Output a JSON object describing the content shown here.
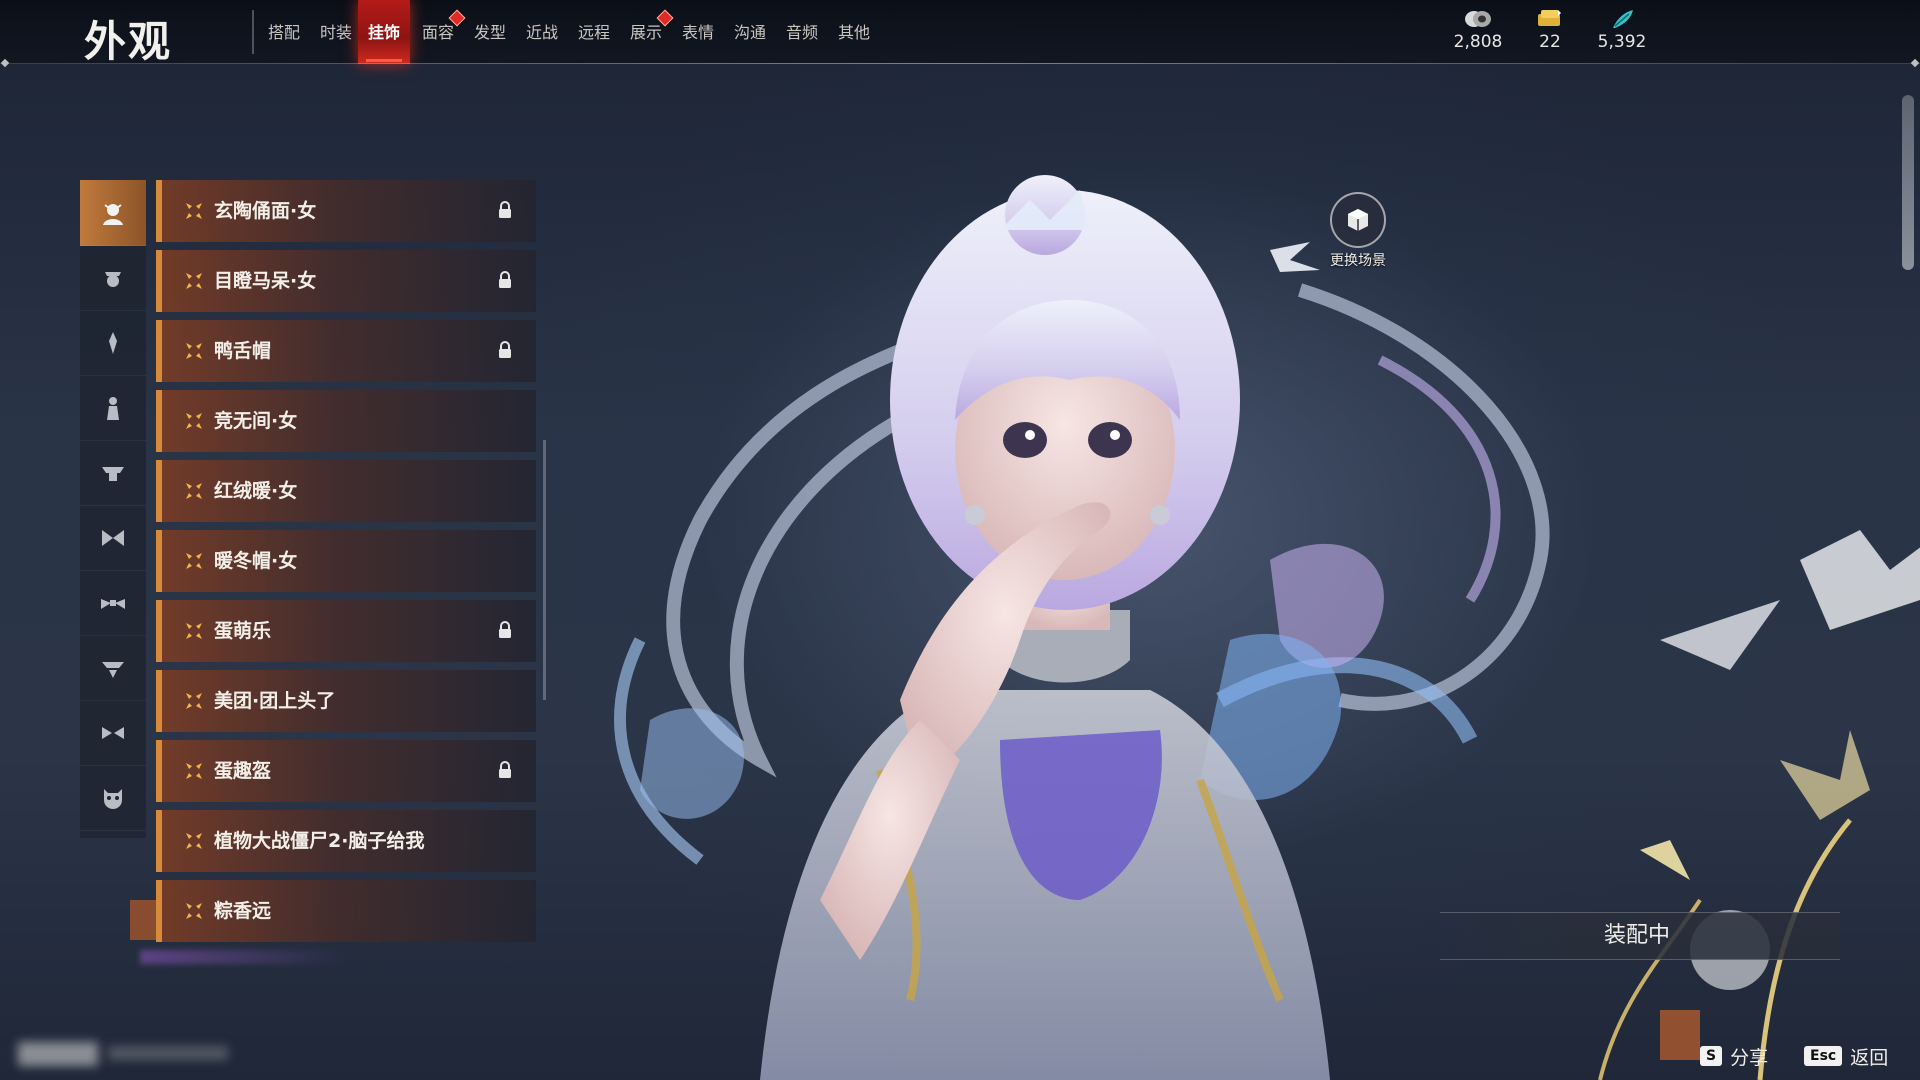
{
  "header": {
    "title": "外观",
    "tabs": [
      {
        "label": "搭配",
        "badge": false
      },
      {
        "label": "时装",
        "badge": false
      },
      {
        "label": "挂饰",
        "badge": false,
        "active": true
      },
      {
        "label": "面容",
        "badge": true
      },
      {
        "label": "发型",
        "badge": false
      },
      {
        "label": "近战",
        "badge": false
      },
      {
        "label": "远程",
        "badge": false
      },
      {
        "label": "展示",
        "badge": true
      },
      {
        "label": "表情",
        "badge": false
      },
      {
        "label": "沟通",
        "badge": false
      },
      {
        "label": "音频",
        "badge": false
      },
      {
        "label": "其他",
        "badge": false
      }
    ],
    "currencies": [
      {
        "icon": "coin-stack-icon",
        "value": "2,808"
      },
      {
        "icon": "ticket-icon",
        "value": "22"
      },
      {
        "icon": "feather-icon",
        "value": "5,392"
      }
    ]
  },
  "categories": [
    {
      "icon": "mask-head-icon",
      "active": true
    },
    {
      "icon": "face-accessory-icon"
    },
    {
      "icon": "hair-ornament-icon"
    },
    {
      "icon": "back-ornament-icon"
    },
    {
      "icon": "waist-icon"
    },
    {
      "icon": "bow-icon"
    },
    {
      "icon": "wing-icon"
    },
    {
      "icon": "cape-icon"
    },
    {
      "icon": "ribbon-icon"
    },
    {
      "icon": "demon-mask-icon"
    }
  ],
  "items": [
    {
      "label": "玄陶俑面·女",
      "locked": true
    },
    {
      "label": "目瞪马呆·女",
      "locked": true
    },
    {
      "label": "鸭舌帽",
      "locked": true
    },
    {
      "label": "竞无间·女",
      "locked": false
    },
    {
      "label": "红绒暖·女",
      "locked": false
    },
    {
      "label": "暖冬帽·女",
      "locked": false
    },
    {
      "label": "蛋萌乐",
      "locked": true
    },
    {
      "label": "美团·团上头了",
      "locked": false
    },
    {
      "label": "蛋趣盔",
      "locked": true
    },
    {
      "label": "植物大战僵尸2·脑子给我",
      "locked": false
    },
    {
      "label": "粽香远",
      "locked": false
    }
  ],
  "scene": {
    "change_scene_label": "更换场景",
    "equipped_label": "装配中"
  },
  "hints": {
    "share_key": "S",
    "share_label": "分享",
    "back_key": "Esc",
    "back_label": "返回"
  },
  "colors": {
    "accent_red": "#b41b17",
    "accent_orange": "#d68a3a",
    "background": "#2a3447"
  }
}
